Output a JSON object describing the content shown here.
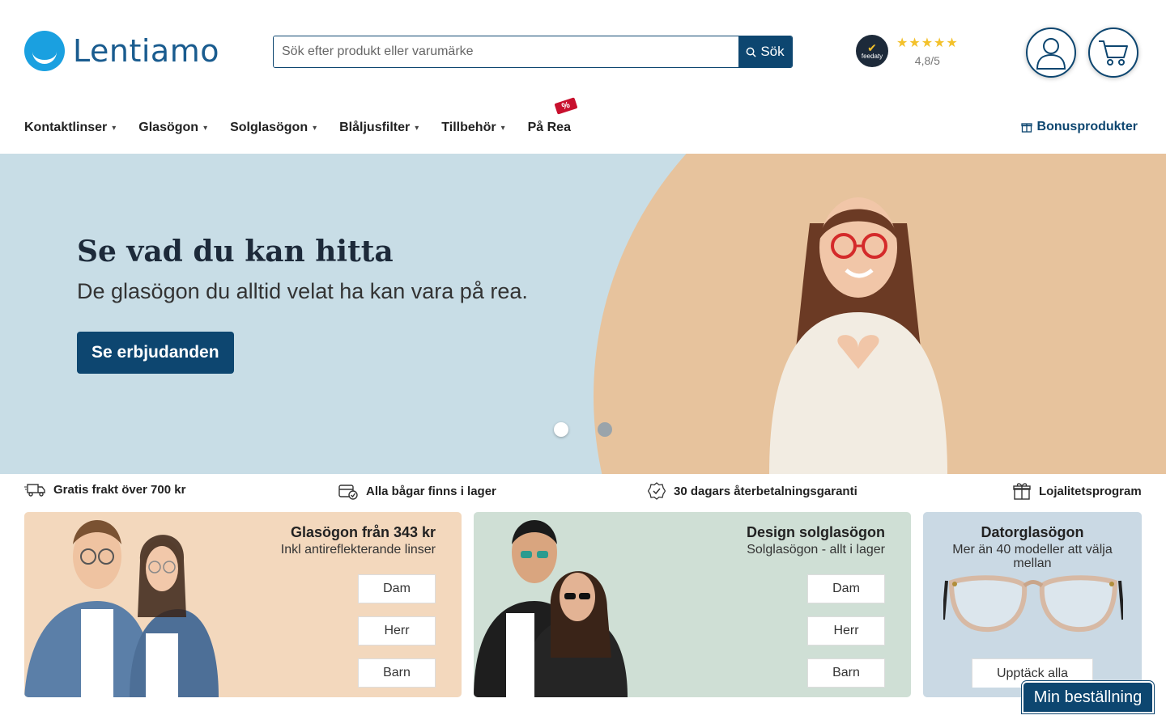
{
  "brand": {
    "name": "Lentiamo"
  },
  "search": {
    "placeholder": "Sök efter produkt eller varumärke",
    "button_label": "Sök"
  },
  "rating": {
    "badge_text": "feedaty",
    "stars": "★★★★★",
    "score": "4,8/5"
  },
  "nav": {
    "items": [
      {
        "label": "Kontaktlinser"
      },
      {
        "label": "Glasögon"
      },
      {
        "label": "Solglasögon"
      },
      {
        "label": "Blåljusfilter"
      },
      {
        "label": "Tillbehör"
      },
      {
        "label": "På Rea",
        "tag": "%"
      }
    ],
    "bonus_label": "Bonusprodukter"
  },
  "hero": {
    "title": "Se vad du kan hitta",
    "subtitle": "De glasögon du alltid velat ha kan vara på rea.",
    "cta_label": "Se erbjudanden"
  },
  "usps": [
    {
      "label": "Gratis frakt över 700 kr",
      "icon": "truck-icon"
    },
    {
      "label": "Alla bågar finns i lager",
      "icon": "stock-icon"
    },
    {
      "label": "30 dagars återbetalningsgaranti",
      "icon": "guarantee-icon"
    },
    {
      "label": "Lojalitetsprogram",
      "icon": "gift-icon"
    }
  ],
  "cards": {
    "glasses": {
      "title": "Glasögon från 343 kr",
      "subtitle": "Inkl antireflekterande linser",
      "buttons": [
        "Dam",
        "Herr",
        "Barn"
      ]
    },
    "sunglasses": {
      "title": "Design solglasögon",
      "subtitle": "Solglasögon - allt i lager",
      "buttons": [
        "Dam",
        "Herr",
        "Barn"
      ]
    },
    "computer": {
      "title": "Datorglasögon",
      "subtitle": "Mer än 40 modeller att välja mellan",
      "button": "Upptäck alla"
    }
  },
  "order_button_label": "Min beställning",
  "colors": {
    "primary": "#0d4670",
    "accent": "#1aa0e0",
    "hero_bg": "#c8dde6",
    "sale": "#c8102e"
  }
}
